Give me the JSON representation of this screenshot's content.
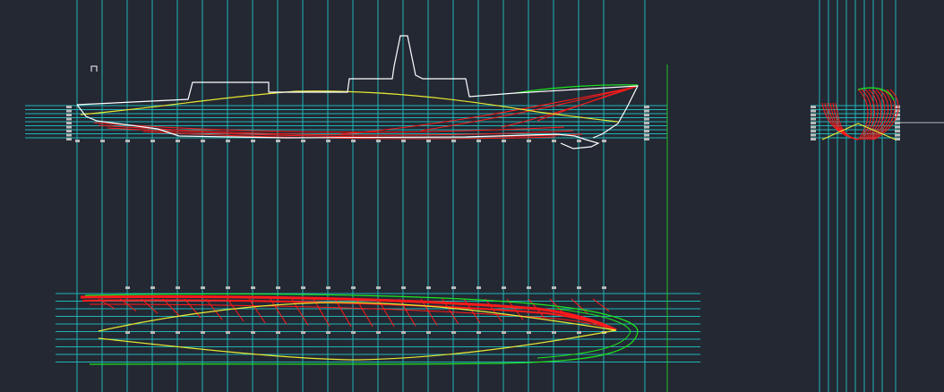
{
  "app": {
    "viewport_name": "cad-model-space"
  },
  "colors": {
    "background": "#232833",
    "grid": "#1fb5b5",
    "hull_outline": "#ffffff",
    "sheer_line": "#e8e832",
    "sections": "#ff1a1a",
    "deck_edge": "#1ee61e",
    "axis": "#22c022",
    "markers": "#b9b9b9"
  },
  "drawing": {
    "views": [
      "profile-view",
      "body-plan-view",
      "half-breadth-view"
    ],
    "layers": [
      "grid",
      "hull-outline",
      "sheer-line",
      "sections",
      "deck-edge",
      "station-markers"
    ]
  }
}
